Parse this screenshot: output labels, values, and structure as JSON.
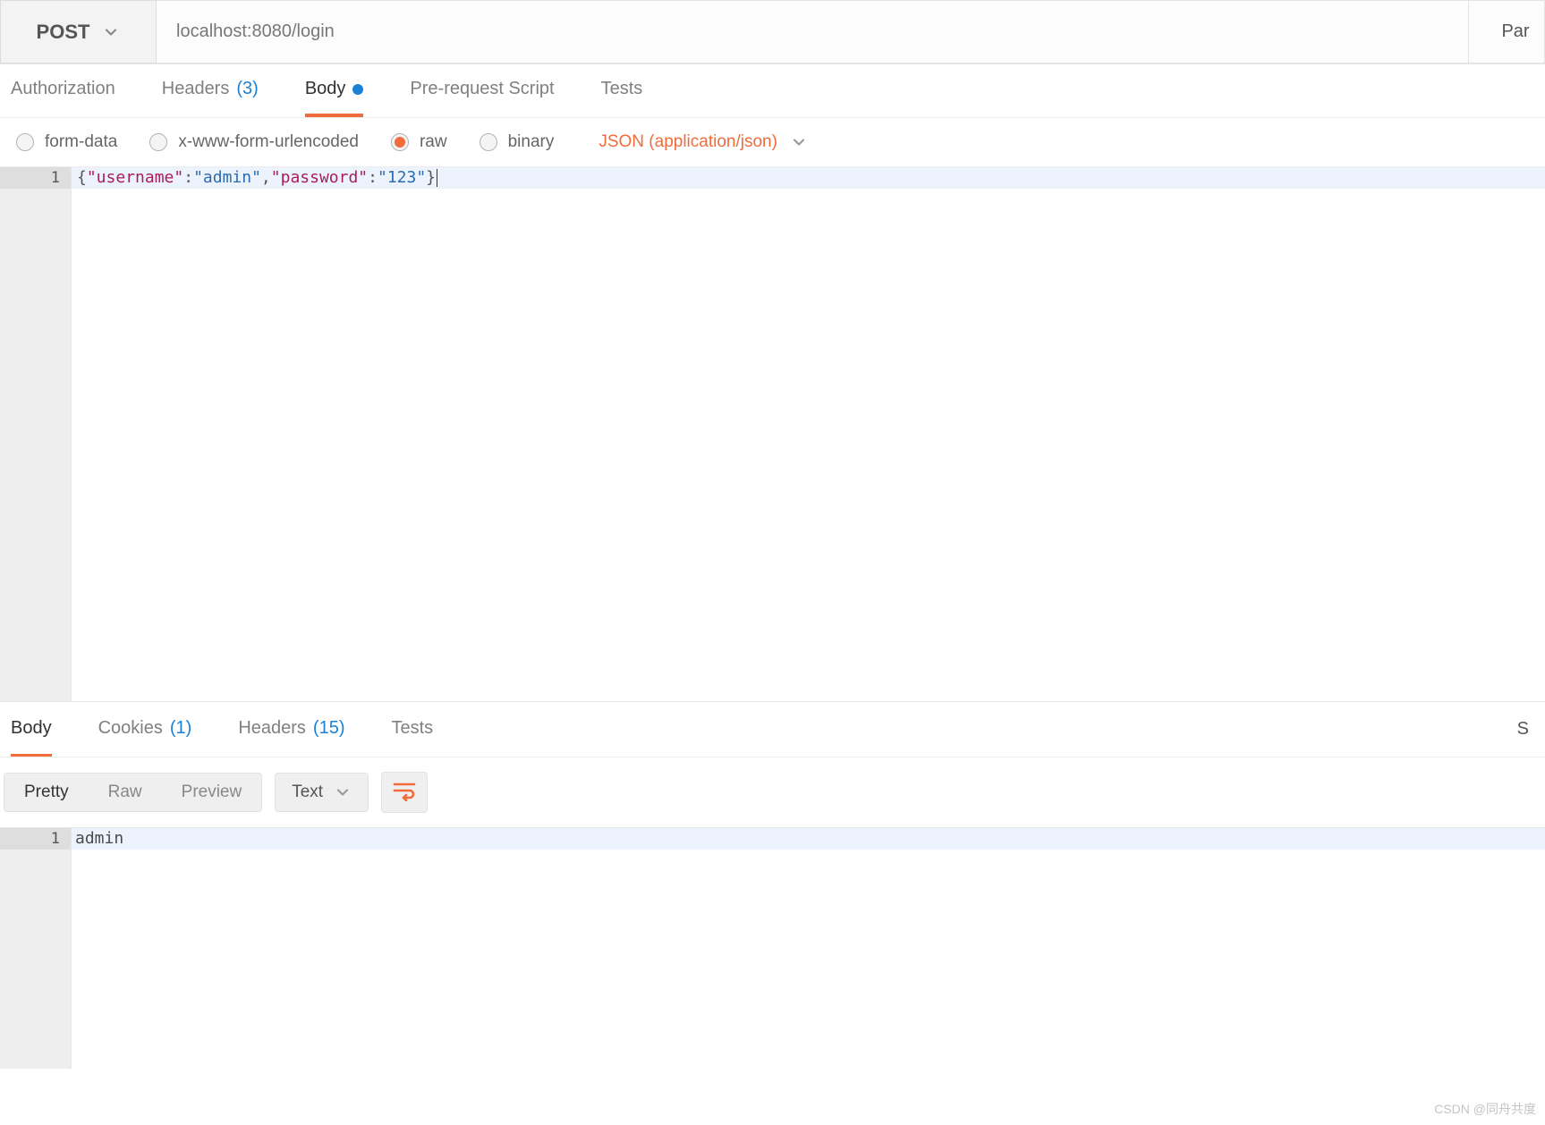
{
  "request": {
    "method": "POST",
    "url": "localhost:8080/login",
    "right_button": "Par"
  },
  "tabs": {
    "authorization": "Authorization",
    "headers_label": "Headers",
    "headers_count": "(3)",
    "body": "Body",
    "prerequest": "Pre-request Script",
    "tests": "Tests"
  },
  "body_types": {
    "form_data": "form-data",
    "urlencoded": "x-www-form-urlencoded",
    "raw": "raw",
    "binary": "binary",
    "content_type": "JSON (application/json)"
  },
  "editor": {
    "line_number": "1",
    "tokens": {
      "open": "{",
      "k1": "\"username\"",
      "c1": ":",
      "v1": "\"admin\"",
      "comma": ",",
      "k2": "\"password\"",
      "c2": ":",
      "v2": "\"123\"",
      "close": "}"
    }
  },
  "response": {
    "tabs": {
      "body": "Body",
      "cookies_label": "Cookies",
      "cookies_count": "(1)",
      "headers_label": "Headers",
      "headers_count": "(15)",
      "tests": "Tests"
    },
    "status_right": "S",
    "viewmodes": {
      "pretty": "Pretty",
      "raw": "Raw",
      "preview": "Preview"
    },
    "format_dropdown": "Text",
    "viewer": {
      "line_number": "1",
      "text": "admin"
    }
  },
  "watermark": "CSDN @同舟共度"
}
